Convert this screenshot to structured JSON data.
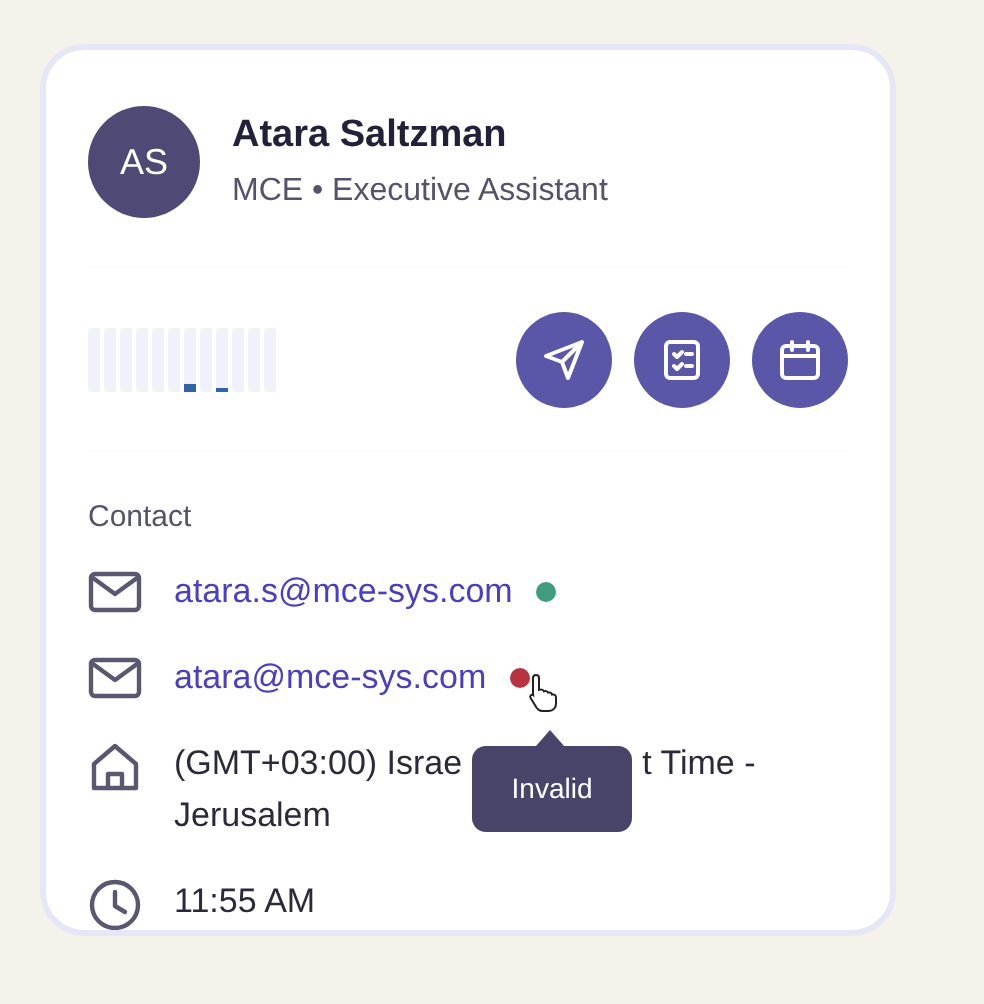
{
  "profile": {
    "initials": "AS",
    "name": "Atara Saltzman",
    "subtitle": "MCE • Executive Assistant"
  },
  "activity": [
    {
      "level": 0
    },
    {
      "level": 0
    },
    {
      "level": 0
    },
    {
      "level": 0
    },
    {
      "level": 0
    },
    {
      "level": 0
    },
    {
      "level": 0.12
    },
    {
      "level": 0
    },
    {
      "level": 0.06
    },
    {
      "level": 0
    },
    {
      "level": 0
    },
    {
      "level": 0
    }
  ],
  "actions": [
    {
      "kind": "send"
    },
    {
      "kind": "tasks"
    },
    {
      "kind": "calendar"
    }
  ],
  "contact": {
    "heading": "Contact",
    "items": [
      {
        "kind": "email",
        "text": "atara.s@mce-sys.com",
        "color": "#3f9c80"
      },
      {
        "kind": "email",
        "text": "atara@mce-sys.com",
        "color": "#b8323f"
      },
      {
        "kind": "timezone",
        "segments": [
          "(GMT+03:00) Israe",
          "t Time -",
          "Jerusalem"
        ]
      },
      {
        "kind": "time",
        "text": "11:55 AM"
      }
    ]
  },
  "tooltip": {
    "text": "Invalid"
  }
}
